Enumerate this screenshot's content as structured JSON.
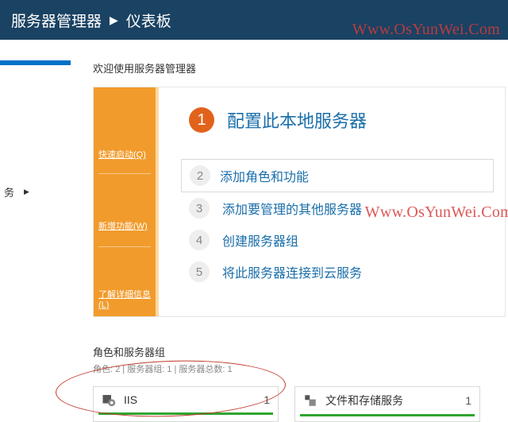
{
  "titlebar": {
    "app": "服务器管理器",
    "page": "仪表板"
  },
  "sidebar": {
    "item_services": "务"
  },
  "welcome": {
    "heading": "欢迎使用服务器管理器",
    "left_panel": {
      "quick_start": "快速启动(Q)",
      "whats_new": "新增功能(W)",
      "learn_more": "了解详细信息(L)"
    },
    "steps": [
      {
        "n": "1",
        "label": "配置此本地服务器"
      },
      {
        "n": "2",
        "label": "添加角色和功能"
      },
      {
        "n": "3",
        "label": "添加要管理的其他服务器"
      },
      {
        "n": "4",
        "label": "创建服务器组"
      },
      {
        "n": "5",
        "label": "将此服务器连接到云服务"
      }
    ]
  },
  "groups": {
    "heading": "角色和服务器组",
    "counts": "角色: 2 | 服务器组: 1 | 服务器总数: 1",
    "cards": [
      {
        "name": "IIS",
        "count": "1"
      },
      {
        "name": "文件和存储服务",
        "count": "1"
      }
    ]
  },
  "watermark": "Www.OsYunWei.Com"
}
